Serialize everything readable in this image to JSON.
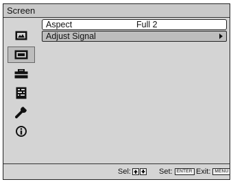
{
  "window": {
    "title": "Screen"
  },
  "sidebar": {
    "items": [
      {
        "icon": "picture-icon",
        "selected": false
      },
      {
        "icon": "screen-icon",
        "selected": true
      },
      {
        "icon": "setup-toolbox-icon",
        "selected": false
      },
      {
        "icon": "menu-list-icon",
        "selected": false
      },
      {
        "icon": "wrench-icon",
        "selected": false
      },
      {
        "icon": "info-icon",
        "selected": false
      }
    ]
  },
  "menu": {
    "rows": [
      {
        "label": "Aspect",
        "value": "Full 2"
      },
      {
        "label": "Adjust Signal",
        "has_submenu": true
      }
    ]
  },
  "footer": {
    "sel_label": "Sel:",
    "set_label": "Set:",
    "set_key": "ENTER",
    "exit_label": "Exit:",
    "exit_key": "MENU"
  },
  "colors": {
    "panel": "#d4d4d4",
    "titlebar": "#c9c9c9",
    "selected_row": "#bdbdbd"
  }
}
